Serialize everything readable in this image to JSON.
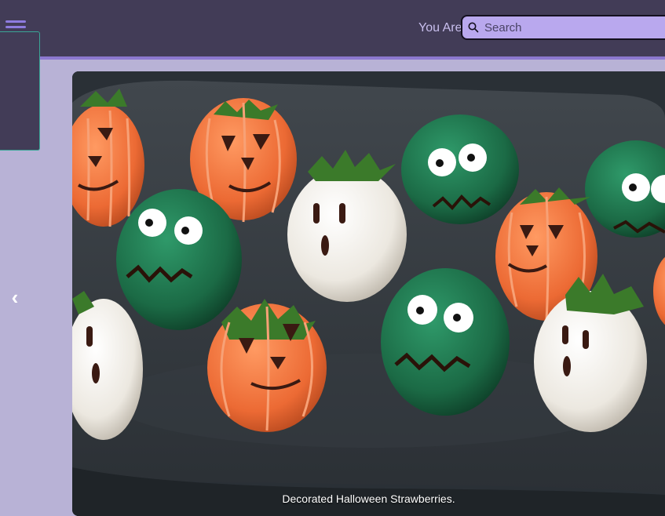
{
  "header": {
    "welcome_text": "You Are",
    "menu_icon": "hamburger-menu-icon"
  },
  "search": {
    "placeholder": "Search",
    "value": "",
    "icon": "search-icon"
  },
  "carousel": {
    "prev_label": "‹",
    "caption": "Decorated Halloween Strawberries."
  },
  "colors": {
    "topbar": "#423c57",
    "accent": "#8c78cf",
    "page_bg": "#b8b2d6",
    "search_bg": "#b9a8ee",
    "panel_border": "#3aa596"
  }
}
